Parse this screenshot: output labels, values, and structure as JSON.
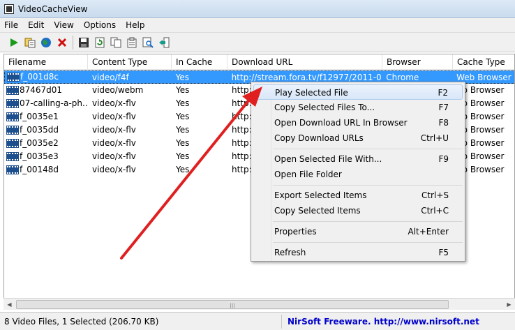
{
  "window": {
    "title": "VideoCacheView"
  },
  "menu": [
    "File",
    "Edit",
    "View",
    "Options",
    "Help"
  ],
  "toolbar": [
    {
      "icon": "play-icon",
      "color": "#1a9a1a"
    },
    {
      "icon": "copy-files-icon",
      "color": "#c8a000"
    },
    {
      "icon": "globe-icon",
      "color": "#1b6fc4"
    },
    {
      "icon": "delete-icon",
      "color": "#d01010"
    },
    {
      "icon": "save-icon",
      "color": "#333333"
    },
    {
      "icon": "refresh-icon",
      "color": "#2a8a2a"
    },
    {
      "icon": "copy-icon",
      "color": "#555555"
    },
    {
      "icon": "properties-icon",
      "color": "#555555"
    },
    {
      "icon": "find-icon",
      "color": "#555555"
    },
    {
      "icon": "exit-icon",
      "color": "#1a9a8a"
    }
  ],
  "columns": [
    "Filename",
    "Content Type",
    "In Cache",
    "Download URL",
    "Browser",
    "Cache Type"
  ],
  "rows": [
    {
      "filename": "f_001d8c",
      "content_type": "video/f4f",
      "in_cache": "Yes",
      "url": "http://stream.fora.tv/f12977/2011-02-...",
      "browser": "Chrome",
      "cache_type": "Web Browser",
      "selected": true
    },
    {
      "filename": "87467d01",
      "content_type": "video/webm",
      "in_cache": "Yes",
      "url": "http:",
      "browser": "",
      "cache_type": "eb Browser",
      "selected": false
    },
    {
      "filename": "07-calling-a-ph...",
      "content_type": "video/x-flv",
      "in_cache": "Yes",
      "url": "http:",
      "browser": "",
      "cache_type": "eb Browser",
      "selected": false
    },
    {
      "filename": "f_0035e1",
      "content_type": "video/x-flv",
      "in_cache": "Yes",
      "url": "http:",
      "browser": "",
      "cache_type": "eb Browser",
      "selected": false
    },
    {
      "filename": "f_0035dd",
      "content_type": "video/x-flv",
      "in_cache": "Yes",
      "url": "http:",
      "browser": "",
      "cache_type": "eb Browser",
      "selected": false
    },
    {
      "filename": "f_0035e2",
      "content_type": "video/x-flv",
      "in_cache": "Yes",
      "url": "http:",
      "browser": "",
      "cache_type": "eb Browser",
      "selected": false
    },
    {
      "filename": "f_0035e3",
      "content_type": "video/x-flv",
      "in_cache": "Yes",
      "url": "http:",
      "browser": "",
      "cache_type": "eb Browser",
      "selected": false
    },
    {
      "filename": "f_00148d",
      "content_type": "video/x-flv",
      "in_cache": "Yes",
      "url": "http:",
      "browser": "",
      "cache_type": "eb Browser",
      "selected": false
    }
  ],
  "context_menu": [
    {
      "label": "Play Selected File",
      "shortcut": "F2"
    },
    {
      "label": "Copy Selected Files To...",
      "shortcut": "F7"
    },
    {
      "label": "Open Download URL In Browser",
      "shortcut": "F8"
    },
    {
      "label": "Copy Download URLs",
      "shortcut": "Ctrl+U"
    },
    {
      "label": "Open Selected File With...",
      "shortcut": "F9"
    },
    {
      "label": "Open File Folder",
      "shortcut": ""
    },
    {
      "label": "Export Selected Items",
      "shortcut": "Ctrl+S"
    },
    {
      "label": "Copy Selected Items",
      "shortcut": "Ctrl+C"
    },
    {
      "label": "Properties",
      "shortcut": "Alt+Enter"
    },
    {
      "label": "Refresh",
      "shortcut": "F5"
    }
  ],
  "status": {
    "summary": "8 Video Files, 1 Selected  (206.70 KB)",
    "credit": "NirSoft Freeware.  http://www.nirsoft.net"
  },
  "colors": {
    "selection": "#3399ff",
    "arrow": "#e02020",
    "credit_text": "#0000cc"
  }
}
